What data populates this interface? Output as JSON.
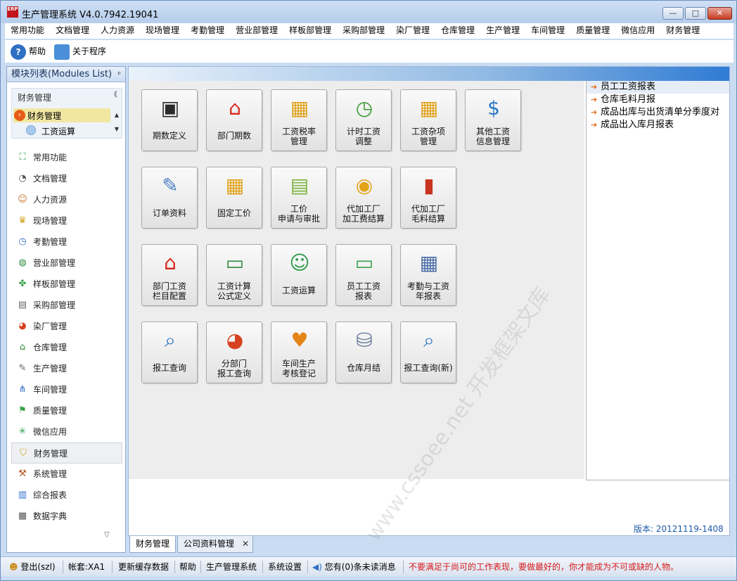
{
  "window": {
    "title": "生产管理系统 V4.0.7942.19041",
    "app_icon_label": "ERP",
    "min_label": "—",
    "max_label": "□",
    "close_label": "✕"
  },
  "menubar": {
    "items": [
      "常用功能",
      "文档管理",
      "人力资源",
      "现场管理",
      "考勤管理",
      "营业部管理",
      "样板部管理",
      "采购部管理",
      "染厂管理",
      "仓库管理",
      "生产管理",
      "车间管理",
      "质量管理",
      "微信应用",
      "财务管理"
    ]
  },
  "toolbar": {
    "help_label": "帮助",
    "about_label": "关于程序"
  },
  "left_panel": {
    "title": "模块列表(Modules List)",
    "pin": "ᵖ",
    "tree": {
      "title": "财务管理",
      "collapse": "⟪",
      "selected_label": "财务管理",
      "sub_label": "工资运算",
      "scroll_up": "▲",
      "scroll_down": "▼"
    },
    "modules": [
      {
        "label": "常用功能",
        "icon": "⛶"
      },
      {
        "label": "文档管理",
        "icon": "◔"
      },
      {
        "label": "人力资源",
        "icon": "☺"
      },
      {
        "label": "现场管理",
        "icon": "♛"
      },
      {
        "label": "考勤管理",
        "icon": "◷"
      },
      {
        "label": "营业部管理",
        "icon": "◍"
      },
      {
        "label": "样板部管理",
        "icon": "✤"
      },
      {
        "label": "采购部管理",
        "icon": "▤"
      },
      {
        "label": "染厂管理",
        "icon": "◕"
      },
      {
        "label": "仓库管理",
        "icon": "⌂"
      },
      {
        "label": "生产管理",
        "icon": "✎"
      },
      {
        "label": "车间管理",
        "icon": "⋔"
      },
      {
        "label": "质量管理",
        "icon": "⚑"
      },
      {
        "label": "微信应用",
        "icon": "✳"
      },
      {
        "label": "财务管理",
        "icon": "⛉"
      },
      {
        "label": "系统管理",
        "icon": "⚒"
      },
      {
        "label": "综合报表",
        "icon": "▥"
      },
      {
        "label": "数据字典",
        "icon": "▦"
      }
    ],
    "scroll_more": "▽"
  },
  "tiles": [
    {
      "label": "期数定义",
      "icon": "▣",
      "color": "#2b2b2b"
    },
    {
      "label": "部门期数",
      "icon": "⌂",
      "color": "#d8281e"
    },
    {
      "label": "工资税率\n管理",
      "icon": "▦",
      "color": "#e0a21a"
    },
    {
      "label": "计时工资\n调整",
      "icon": "◷",
      "color": "#3a9a2e"
    },
    {
      "label": "工资杂项\n管理",
      "icon": "▦",
      "color": "#e0a21a"
    },
    {
      "label": "其他工资\n信息管理",
      "icon": "$",
      "color": "#2a78c9"
    },
    {
      "label": "订单资料",
      "icon": "✎",
      "color": "#4a7fc0"
    },
    {
      "label": "固定工价",
      "icon": "▦",
      "color": "#e0a21a"
    },
    {
      "label": "工价\n申请与审批",
      "icon": "▤",
      "color": "#7bb33a"
    },
    {
      "label": "代加工厂\n加工费结算",
      "icon": "◉",
      "color": "#e3a417"
    },
    {
      "label": "代加工厂\n毛料结算",
      "icon": "▮",
      "color": "#c8341f"
    },
    {
      "label": "部门工资\n栏目配置",
      "icon": "⌂",
      "color": "#d8281e"
    },
    {
      "label": "工资计算\n公式定义",
      "icon": "▭",
      "color": "#2f8a3c"
    },
    {
      "label": "工资运算",
      "icon": "☺",
      "color": "#2f9c4a"
    },
    {
      "label": "员工工资\n报表",
      "icon": "▭",
      "color": "#3aa24a"
    },
    {
      "label": "考勤与工资\n年报表",
      "icon": "▦",
      "color": "#4d6ea8"
    },
    {
      "label": "报工查询",
      "icon": "⌕",
      "color": "#2f76c5"
    },
    {
      "label": "分部门\n报工查询",
      "icon": "◕",
      "color": "#d6421f"
    },
    {
      "label": "车间生产\n考核登记",
      "icon": "♥",
      "color": "#e4851a"
    },
    {
      "label": "仓库月结",
      "icon": "⛁",
      "color": "#6b7f9a"
    },
    {
      "label": "报工查询(新)",
      "icon": "⌕",
      "color": "#2f76c5"
    }
  ],
  "reports": [
    {
      "label": "员工工资报表"
    },
    {
      "label": "仓库毛料月报"
    },
    {
      "label": "成品出库与出货清单分季度对"
    },
    {
      "label": "成品出入库月报表"
    }
  ],
  "report_arrow": "➔",
  "watermark": "www.cssoee.net 开发框架文库",
  "version": "版本: 20121119-1408",
  "doc_tabs": {
    "active": "财务管理",
    "inactive": "公司资料管理",
    "close": "✕"
  },
  "status_bar": {
    "logout": "登出(szl)",
    "account": "帐套:XA1",
    "refresh_cache": "更新缓存数据",
    "help": "帮助",
    "system": "生产管理系统",
    "settings": "系统设置",
    "messages": "您有(0)条未读消息",
    "motto": "不要满足于尚可的工作表现，要做最好的，你才能成为不可或缺的人物。"
  },
  "colors": {
    "accent": "#2f7bd4",
    "selection": "#f1e7a1",
    "motto": "#d61b1b"
  }
}
